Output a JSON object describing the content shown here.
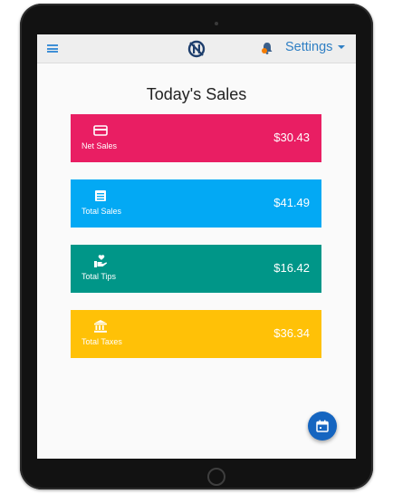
{
  "header": {
    "settings_label": "Settings"
  },
  "page_title": "Today's Sales",
  "cards": [
    {
      "label": "Net Sales",
      "value": "$30.43",
      "color": "#e91e63",
      "icon": "credit-card-icon"
    },
    {
      "label": "Total Sales",
      "value": "$41.49",
      "color": "#03a9f4",
      "icon": "receipt-icon"
    },
    {
      "label": "Total Tips",
      "value": "$16.42",
      "color": "#009688",
      "icon": "hand-heart-icon"
    },
    {
      "label": "Total Taxes",
      "value": "$36.34",
      "color": "#ffc107",
      "icon": "bank-icon"
    }
  ],
  "icons": {
    "menu": "menu-icon",
    "logo": "logo-icon",
    "notifications": "bell-icon",
    "calendar": "calendar-icon"
  },
  "colors": {
    "accent": "#2f7fc4",
    "topbar_bg": "#eeeeee",
    "fab_bg": "#1565c0"
  }
}
